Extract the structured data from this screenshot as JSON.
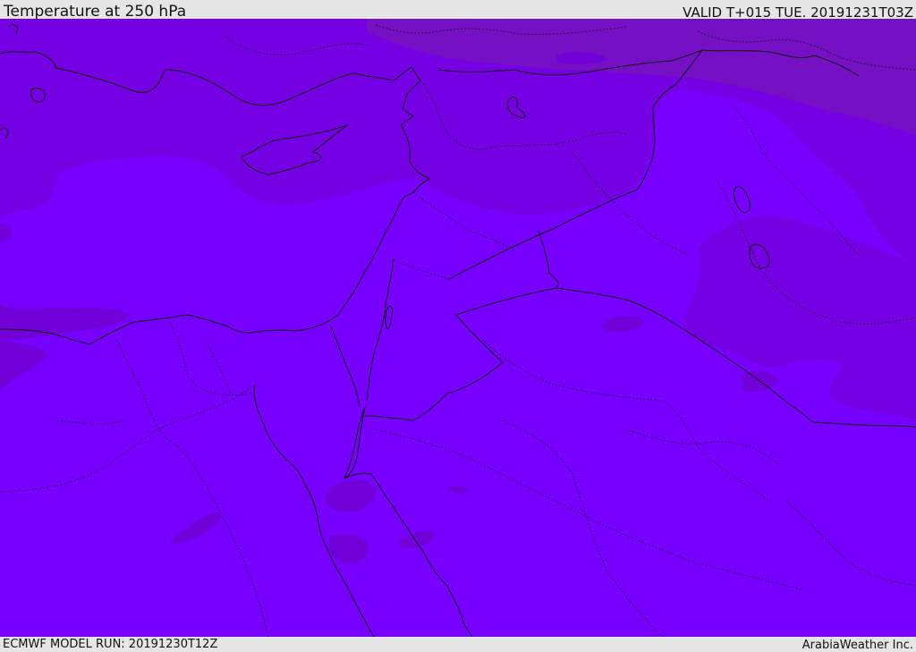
{
  "header": {
    "title": "Temperature at 250 hPa",
    "valid_time": "VALID T+015 TUE. 20191231T03Z"
  },
  "footer": {
    "model_run": "ECMWF MODEL RUN: 20191230T12Z",
    "credit": "ArabiaWeather Inc."
  },
  "colors": {
    "field_base": "#7700ff",
    "field_cooler": "#7600e4",
    "field_coldest": "#7510c4",
    "field_patch": "#7200d8",
    "background": "#e6e6e6"
  }
}
